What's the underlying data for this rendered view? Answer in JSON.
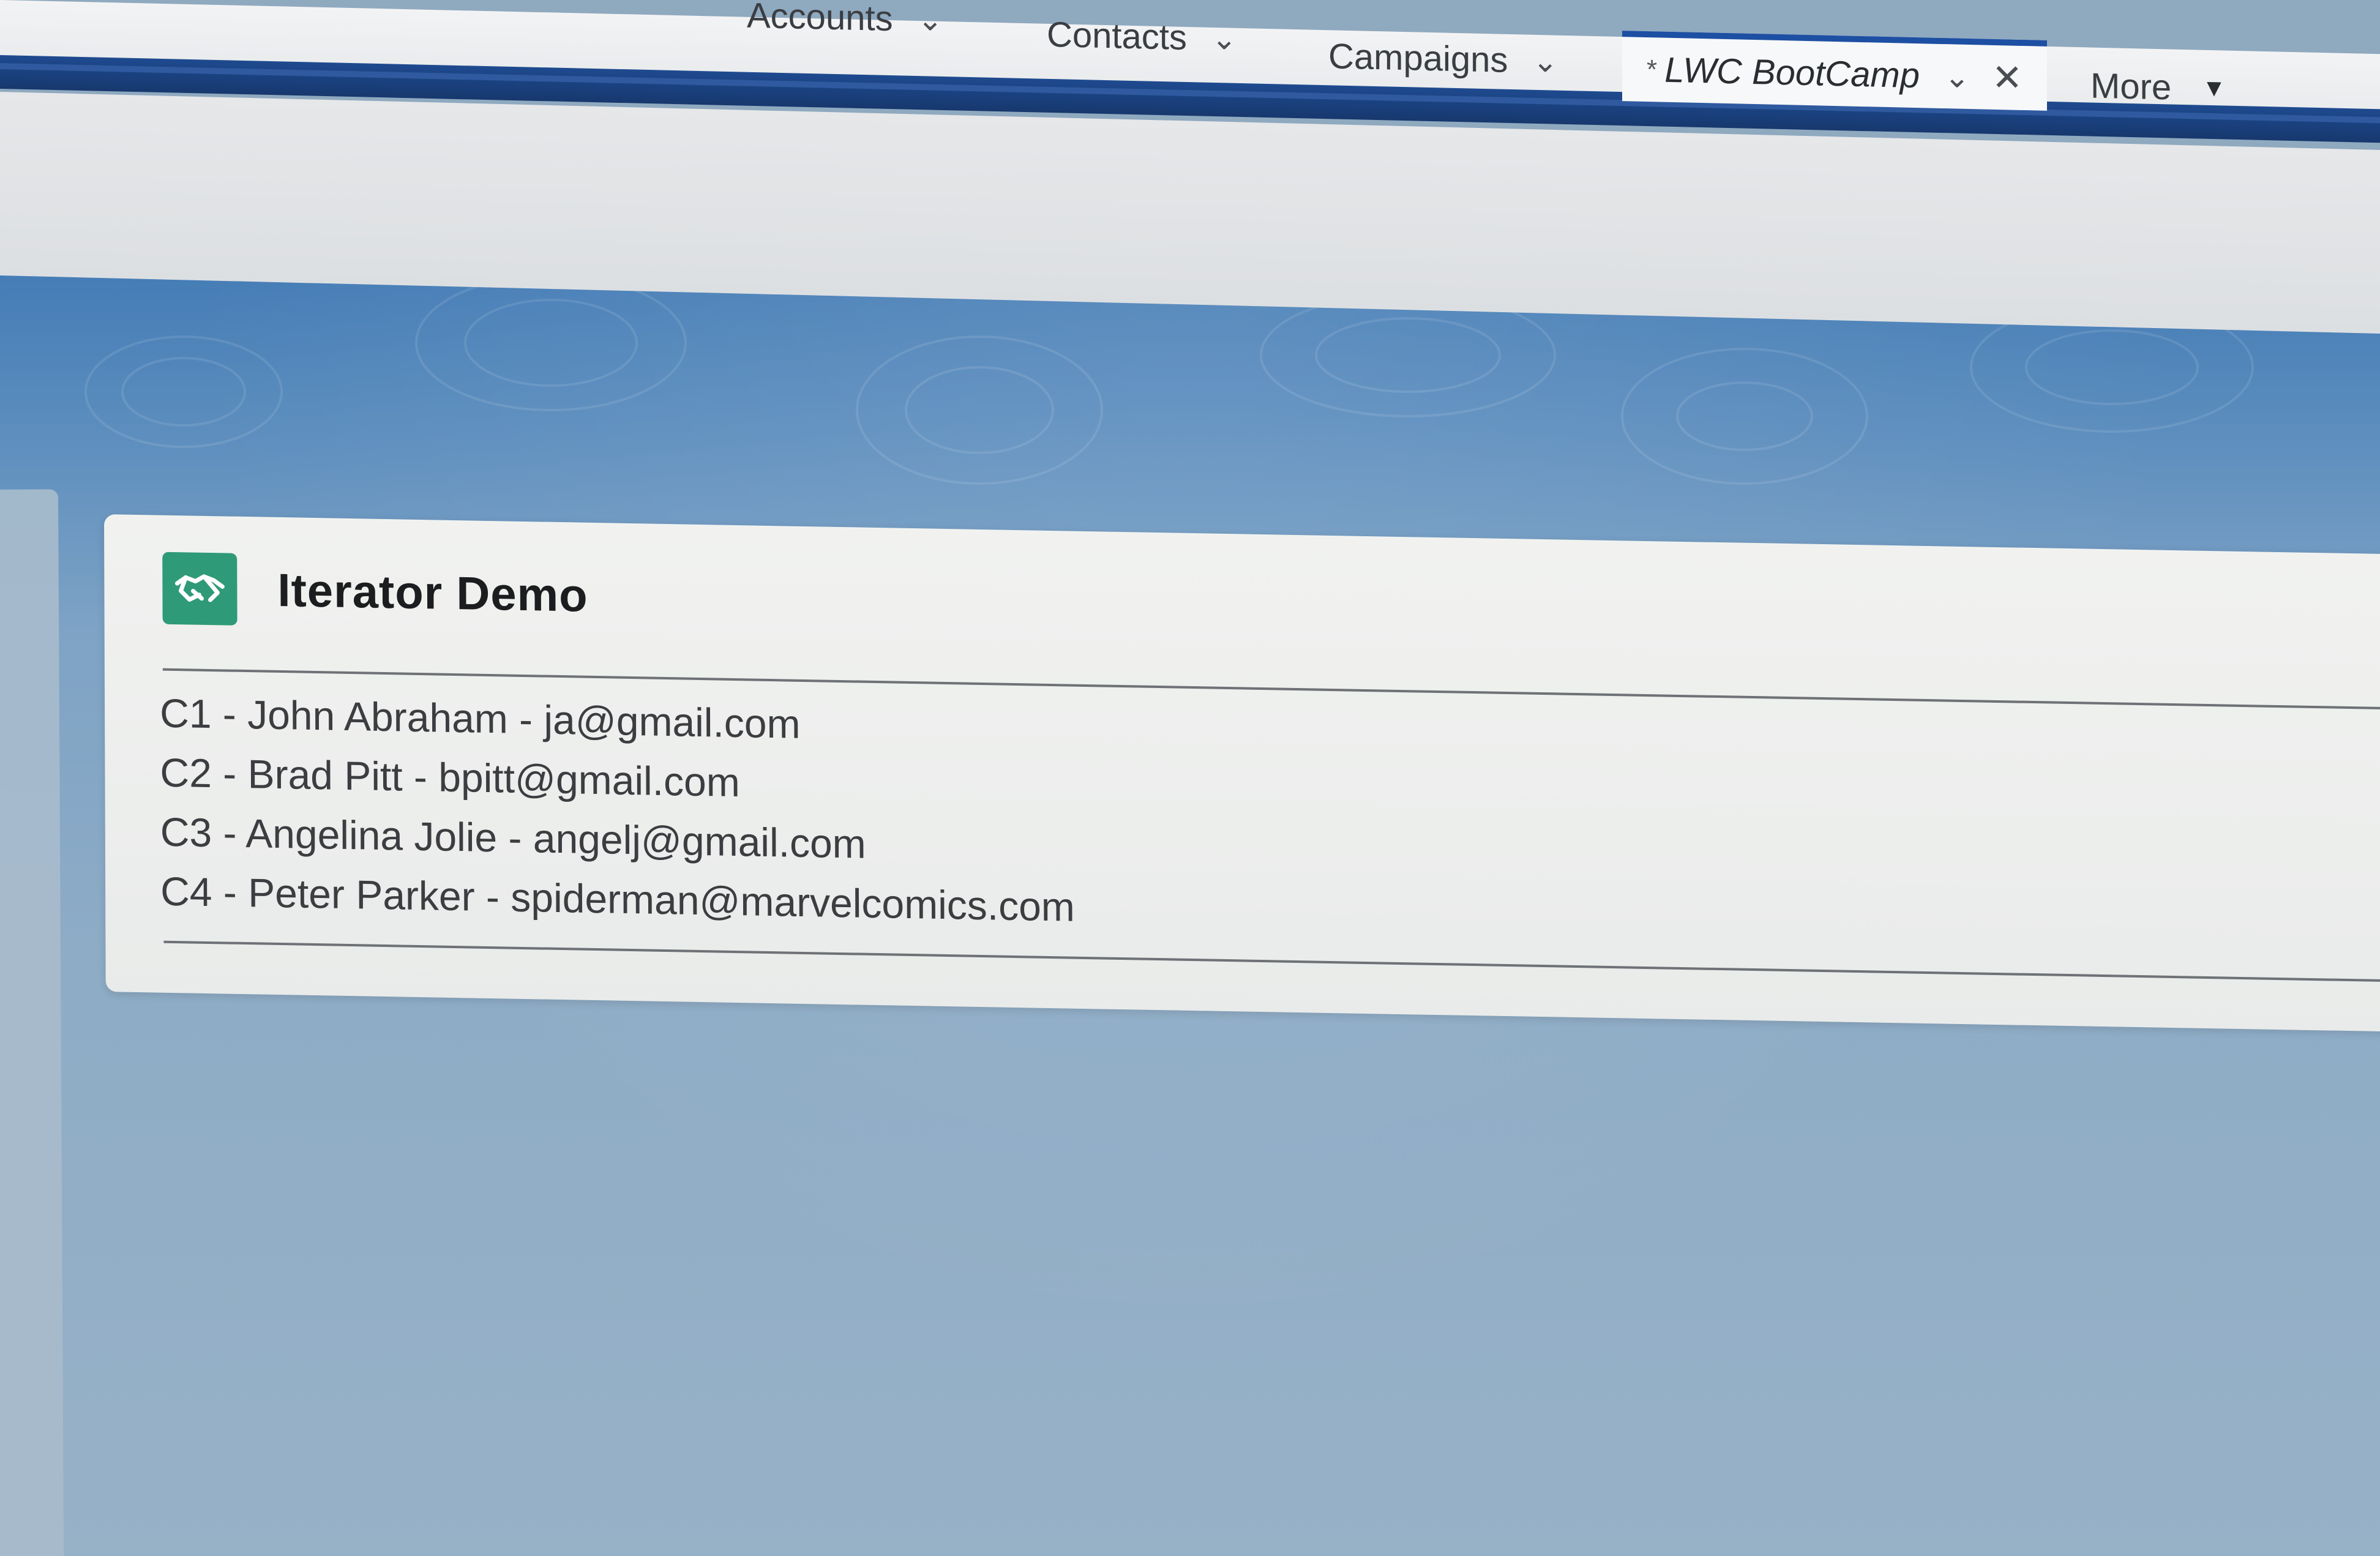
{
  "nav": {
    "tabs": [
      {
        "label": "Accounts"
      },
      {
        "label": "Contacts"
      },
      {
        "label": "Campaigns"
      }
    ],
    "active_tab": {
      "dirty_marker": "*",
      "label": "LWC BootCamp"
    },
    "more_label": "More",
    "colors": {
      "accent": "#1e4a8f",
      "active_tab_border": "#1d4fa3"
    }
  },
  "card": {
    "title": "Iterator Demo",
    "icon": "handshake-icon",
    "icon_color": "#2f9a77",
    "contacts": [
      "C1 - John Abraham - ja@gmail.com",
      "C2 - Brad Pitt - bpitt@gmail.com",
      "C3 - Angelina Jolie - angelj@gmail.com",
      "C4 - Peter Parker - spiderman@marvelcomics.com"
    ]
  }
}
